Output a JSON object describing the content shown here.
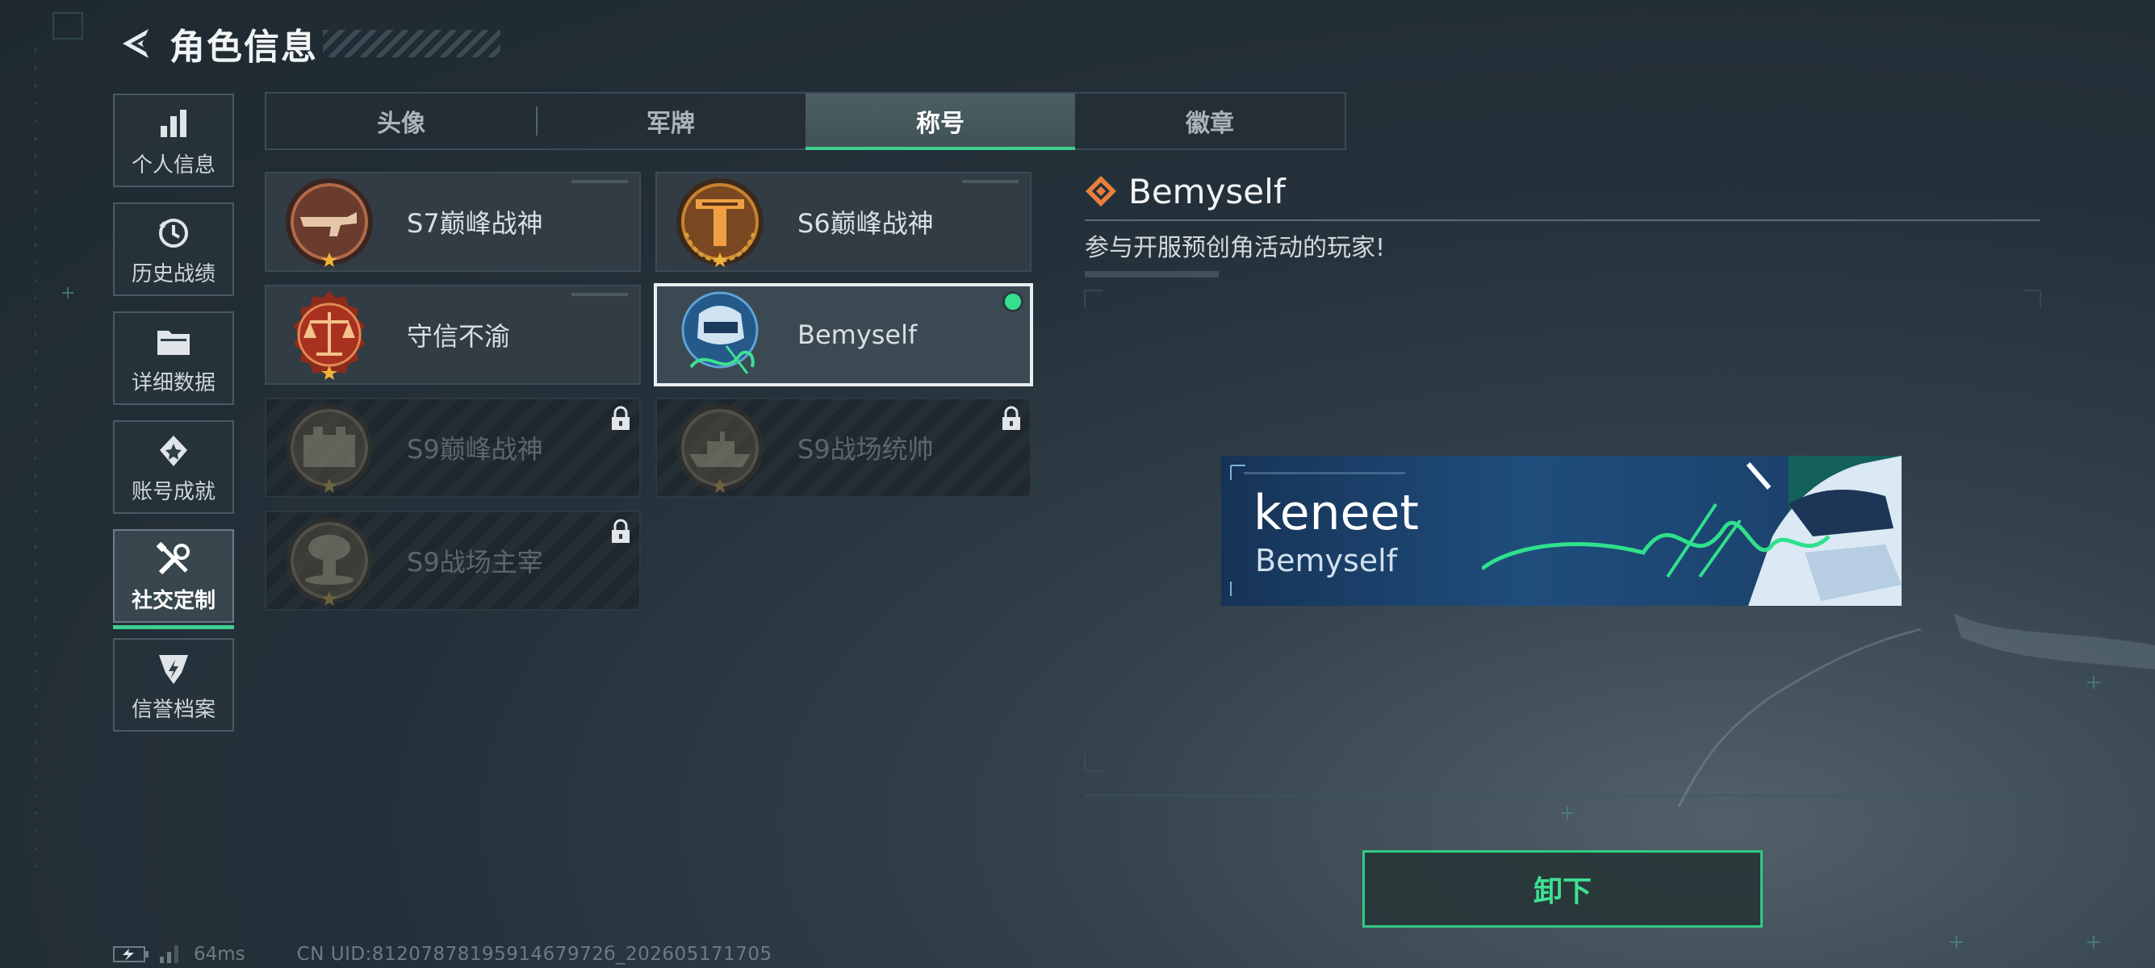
{
  "header": {
    "title": "角色信息"
  },
  "sidebar": {
    "items": [
      {
        "label": "个人信息",
        "icon": "bar-chart-icon",
        "active": false
      },
      {
        "label": "历史战绩",
        "icon": "history-icon",
        "active": false
      },
      {
        "label": "详细数据",
        "icon": "folder-icon",
        "active": false
      },
      {
        "label": "账号成就",
        "icon": "achievement-icon",
        "active": false
      },
      {
        "label": "社交定制",
        "icon": "tools-icon",
        "active": true
      },
      {
        "label": "信誉档案",
        "icon": "credit-icon",
        "active": false
      }
    ]
  },
  "tabs": [
    {
      "label": "头像",
      "active": false
    },
    {
      "label": "军牌",
      "active": false
    },
    {
      "label": "称号",
      "active": true
    },
    {
      "label": "徽章",
      "active": false
    }
  ],
  "titles": [
    {
      "name": "S7巅峰战神",
      "icon": "gun-medal-icon",
      "locked": false,
      "selected": false
    },
    {
      "name": "S6巅峰战神",
      "icon": "t-shield-medal-icon",
      "locked": false,
      "selected": false
    },
    {
      "name": "守信不渝",
      "icon": "scales-medal-icon",
      "locked": false,
      "selected": false
    },
    {
      "name": "Bemyself",
      "icon": "soldier-signature-icon",
      "locked": false,
      "selected": true
    },
    {
      "name": "S9巅峰战神",
      "icon": "fortress-medal-icon",
      "locked": true,
      "selected": false
    },
    {
      "name": "S9战场统帅",
      "icon": "warship-medal-icon",
      "locked": true,
      "selected": false
    },
    {
      "name": "S9战场主宰",
      "icon": "mushroom-cloud-medal-icon",
      "locked": true,
      "selected": false
    }
  ],
  "detail": {
    "name": "Bemyself",
    "description": "参与开服预创角活动的玩家!",
    "banner": {
      "player_name": "keneet",
      "title": "Bemyself"
    },
    "unequip_label": "卸下"
  },
  "status": {
    "ping": "64ms",
    "uid": "CN UID:8120787819591467972б_202605171705"
  },
  "colors": {
    "accent": "#3ecf8e",
    "background": "#25313a",
    "banner": "#1f4d7c"
  }
}
